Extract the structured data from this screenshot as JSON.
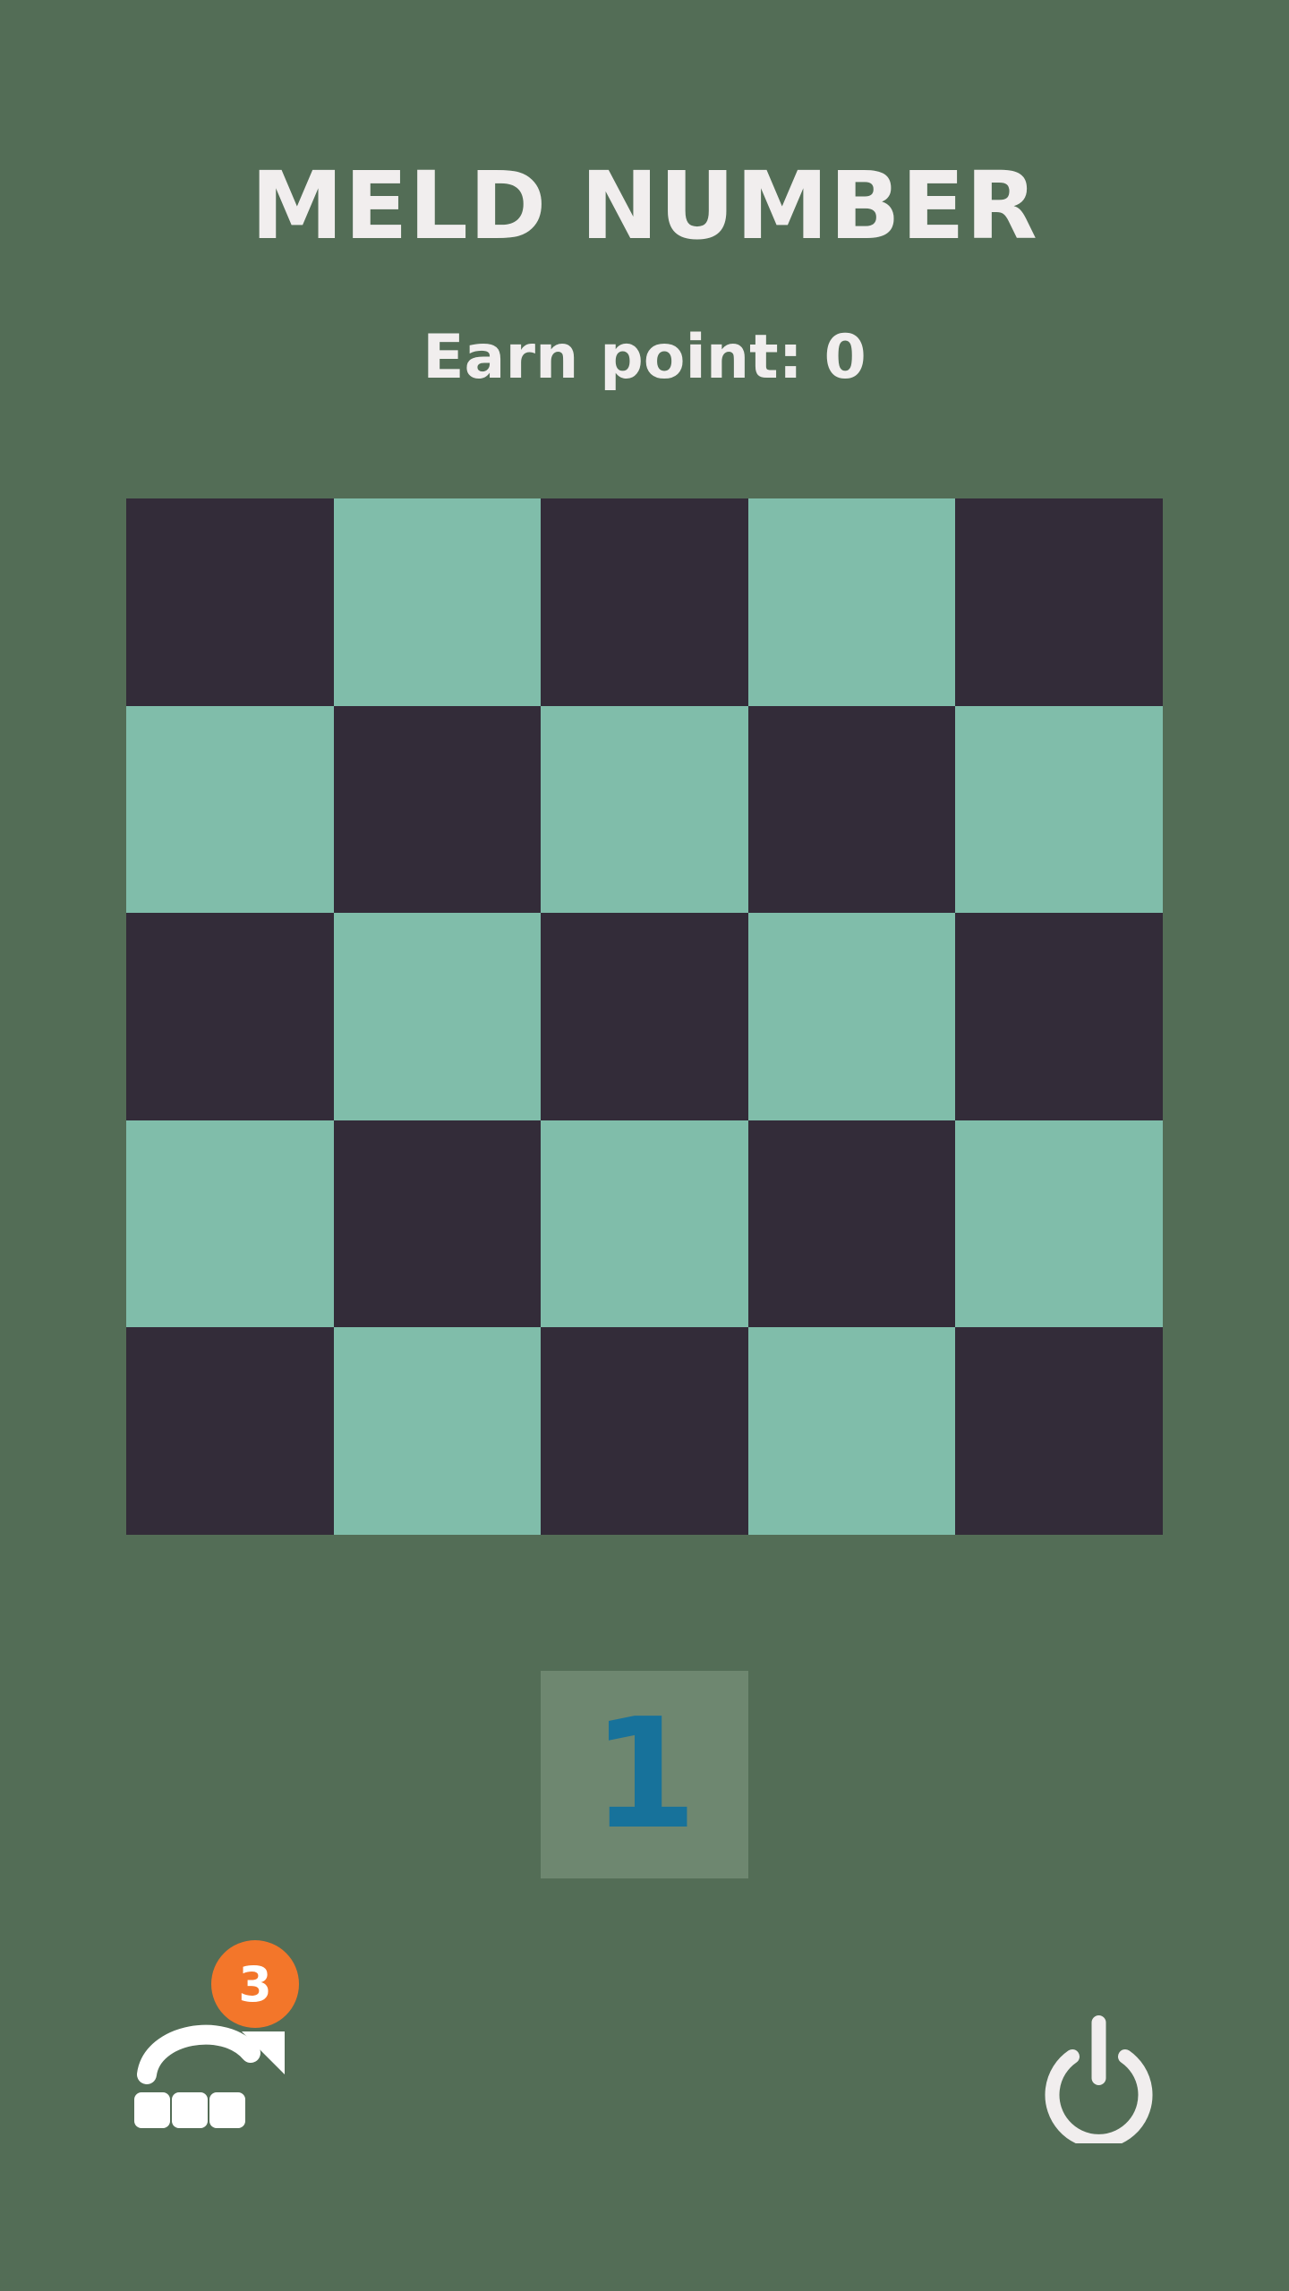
{
  "header": {
    "title": "MELD NUMBER",
    "score_text": "Earn point: 0"
  },
  "board": {
    "rows": 5,
    "cols": 5,
    "dark_color": "#332c39",
    "light_color": "#80bdaa",
    "cells": [
      [
        "dark",
        "light",
        "dark",
        "light",
        "dark"
      ],
      [
        "light",
        "dark",
        "light",
        "dark",
        "light"
      ],
      [
        "dark",
        "light",
        "dark",
        "light",
        "dark"
      ],
      [
        "light",
        "dark",
        "light",
        "dark",
        "light"
      ],
      [
        "dark",
        "light",
        "dark",
        "light",
        "dark"
      ]
    ]
  },
  "current_tile": {
    "value": "1",
    "color": "#17729b"
  },
  "controls": {
    "swap_icon": "swap-tiles-icon",
    "swap_count": "3",
    "badge_color": "#f3762a",
    "power_icon": "power-icon"
  }
}
